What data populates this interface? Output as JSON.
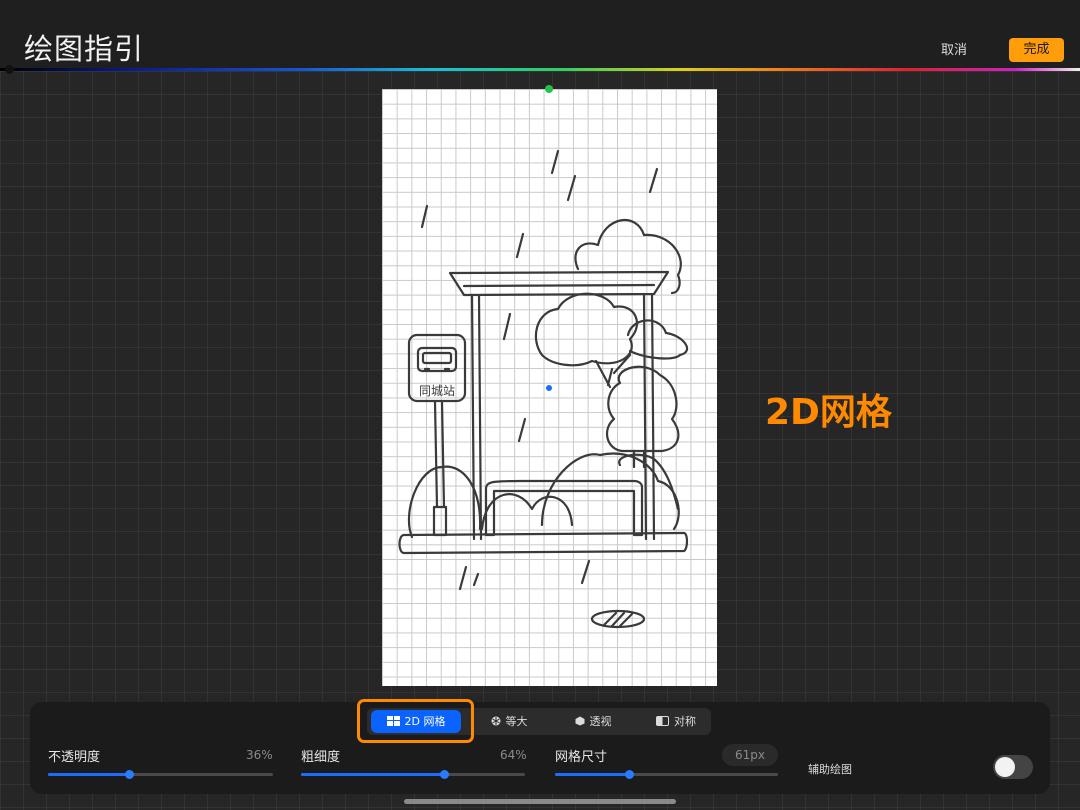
{
  "header": {
    "title": "绘图指引",
    "cancel_label": "取消",
    "done_label": "完成"
  },
  "colors": {
    "accent": "#ff9d0a",
    "active_tab": "#0a62ff",
    "slider_fill": "#1d6cff"
  },
  "callout": {
    "text": "2D网格"
  },
  "mode_tabs": [
    {
      "label": "2D 网格",
      "icon": "grid-icon",
      "active": true
    },
    {
      "label": "等大",
      "icon": "isometric-icon",
      "active": false
    },
    {
      "label": "透视",
      "icon": "perspective-icon",
      "active": false
    },
    {
      "label": "对称",
      "icon": "symmetry-icon",
      "active": false
    }
  ],
  "sliders": {
    "opacity": {
      "label": "不透明度",
      "value_text": "36%",
      "value": 36
    },
    "thickness": {
      "label": "粗细度",
      "value_text": "64%",
      "value": 64
    },
    "grid_size": {
      "label": "网格尺寸",
      "value_text": "61px",
      "value": 33
    }
  },
  "assisted_drawing": {
    "label": "辅助绘图",
    "enabled": false
  },
  "sketch": {
    "sign_text": "同城站"
  }
}
